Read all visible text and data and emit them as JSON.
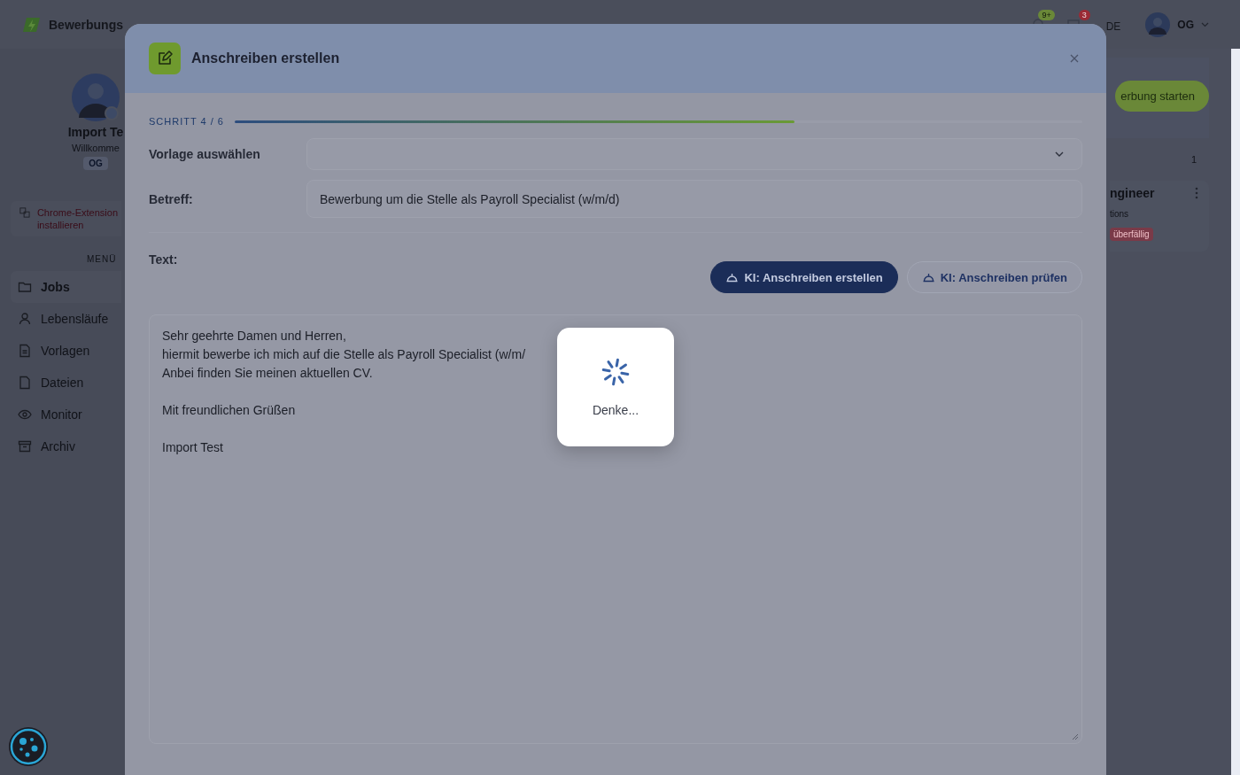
{
  "app": {
    "logo_text": "Bewerbungs",
    "header": {
      "notifications_badge": "9+",
      "messages_badge": "3",
      "language": "DE",
      "user_initials": "OG"
    },
    "profile": {
      "name": "Import Te",
      "greeting": "Willkomme",
      "initials": "OG"
    },
    "extension_link": [
      "Chrome-Extension",
      "installieren"
    ],
    "menu_title": "MENÜ",
    "menu": [
      {
        "label": "Jobs",
        "selected": true
      },
      {
        "label": "Lebensläufe",
        "selected": false
      },
      {
        "label": "Vorlagen",
        "selected": false
      },
      {
        "label": "Dateien",
        "selected": false
      },
      {
        "label": "Monitor",
        "selected": false
      },
      {
        "label": "Archiv",
        "selected": false
      }
    ],
    "start_button": "erbung starten",
    "column_count": "1",
    "job_card": {
      "title": "ngineer",
      "company": "tions",
      "status": "überfällig"
    }
  },
  "modal": {
    "title": "Anschreiben erstellen",
    "step": {
      "label": "SCHRITT 4 / 6",
      "level": 0.66
    },
    "template": {
      "label": "Vorlage auswählen"
    },
    "subject": {
      "label": "Betreff:",
      "value": "Bewerbung um die Stelle als Payroll Specialist (w/m/d)"
    },
    "text_label": "Text:",
    "buttons": [
      {
        "label": "KI: Anschreiben erstellen",
        "primary": true
      },
      {
        "label": "KI: Anschreiben prüfen",
        "primary": false
      }
    ],
    "body_paragraphs": [
      [
        "Sehr geehrte Damen und Herren,",
        "hiermit bewerbe ich mich auf die Stelle als Payroll Specialist (w/m/",
        "Anbei finden Sie meinen aktuellen CV."
      ],
      [
        "Mit freundlichen Grüßen"
      ],
      [
        "Import Test"
      ]
    ]
  },
  "loading": {
    "text": "Denke..."
  }
}
